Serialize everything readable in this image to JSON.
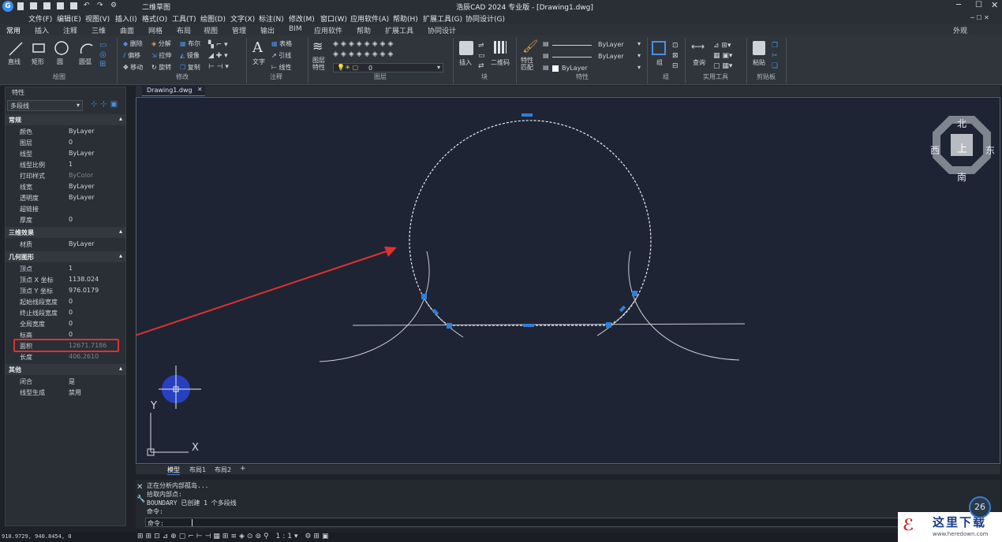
{
  "titlebar": {
    "title": "浩辰CAD 2024 专业版 - [Drawing1.dwg]",
    "workspace": "二维草图"
  },
  "menu": [
    "文件(F)",
    "编辑(E)",
    "视图(V)",
    "插入(I)",
    "格式(O)",
    "工具(T)",
    "绘图(D)",
    "文字(X)",
    "标注(N)",
    "修改(M)",
    "窗口(W)",
    "应用软件(A)",
    "帮助(H)",
    "扩展工具(G)",
    "协同设计(G)"
  ],
  "tabs": [
    "常用",
    "插入",
    "注释",
    "三维",
    "曲面",
    "网格",
    "布局",
    "视图",
    "管理",
    "输出",
    "BIM",
    "应用软件",
    "帮助",
    "扩展工具",
    "协同设计"
  ],
  "tabs_right": "外观",
  "ribbon": {
    "draw": {
      "line": "直线",
      "rect": "矩形",
      "circle": "圆",
      "arc": "圆弧",
      "label": "绘图"
    },
    "modify": {
      "erase": "删除",
      "explode": "分解",
      "array": "布尔",
      "offset": "偏移",
      "stretch": "拉伸",
      "mirror": "镜像",
      "move": "移动",
      "rotate": "旋转",
      "copy": "复制",
      "label": "修改"
    },
    "annotate": {
      "text": "文字",
      "table": "表格",
      "leader": "引线",
      "linear": "线性",
      "label": "注释"
    },
    "layers": {
      "props": "图层\n特性",
      "current": "0",
      "label": "图层"
    },
    "block": {
      "insert": "插入",
      "qr": "二维码",
      "label": "块"
    },
    "properties": {
      "match": "特性\n匹配",
      "bylayer1": "ByLayer",
      "bylayer2": "ByLayer",
      "bylayer3": "ByLayer",
      "label": "特性"
    },
    "group": {
      "group": "组",
      "label": "组"
    },
    "utilities": {
      "query": "查询",
      "label": "实用工具"
    },
    "clipboard": {
      "paste": "粘贴",
      "label": "剪贴板"
    }
  },
  "props": {
    "header": "特性",
    "selector": "多段线",
    "sections": [
      {
        "title": "常规",
        "rows": [
          [
            "颜色",
            "ByLayer"
          ],
          [
            "图层",
            "0"
          ],
          [
            "线型",
            "ByLayer"
          ],
          [
            "线型比例",
            "1"
          ],
          [
            "打印样式",
            "ByColor"
          ],
          [
            "线宽",
            "ByLayer"
          ],
          [
            "透明度",
            "ByLayer"
          ],
          [
            "超链接",
            ""
          ],
          [
            "厚度",
            "0"
          ]
        ]
      },
      {
        "title": "三维效果",
        "rows": [
          [
            "材质",
            "ByLayer"
          ]
        ]
      },
      {
        "title": "几何图形",
        "rows": [
          [
            "顶点",
            "1"
          ],
          [
            "顶点 X 坐标",
            "1138.024"
          ],
          [
            "顶点 Y 坐标",
            "976.0179"
          ],
          [
            "起始线段宽度",
            "0"
          ],
          [
            "终止线段宽度",
            "0"
          ],
          [
            "全局宽度",
            "0"
          ],
          [
            "标高",
            "0"
          ],
          [
            "面积",
            "12671.7186"
          ],
          [
            "长度",
            "406.2610"
          ]
        ]
      },
      {
        "title": "其他",
        "rows": [
          [
            "闭合",
            "是"
          ],
          [
            "线型生成",
            "禁用"
          ]
        ]
      }
    ]
  },
  "doc_tab": "Drawing1.dwg",
  "layout_tabs": [
    "模型",
    "布局1",
    "布局2"
  ],
  "viewcube": {
    "north": "北",
    "south": "南",
    "east": "东",
    "west": "西",
    "top": "上"
  },
  "command_history": [
    "正在分析内部孤岛...",
    "拾取内部点:",
    "BOUNDARY 已创建 1 个多段线",
    "命令:"
  ],
  "command_prompt": "命令:",
  "status_coords": "910.9729, 940.8454, 0",
  "watermark": {
    "text": "这里下载",
    "url": "www.heredown.com"
  },
  "badge": "26"
}
